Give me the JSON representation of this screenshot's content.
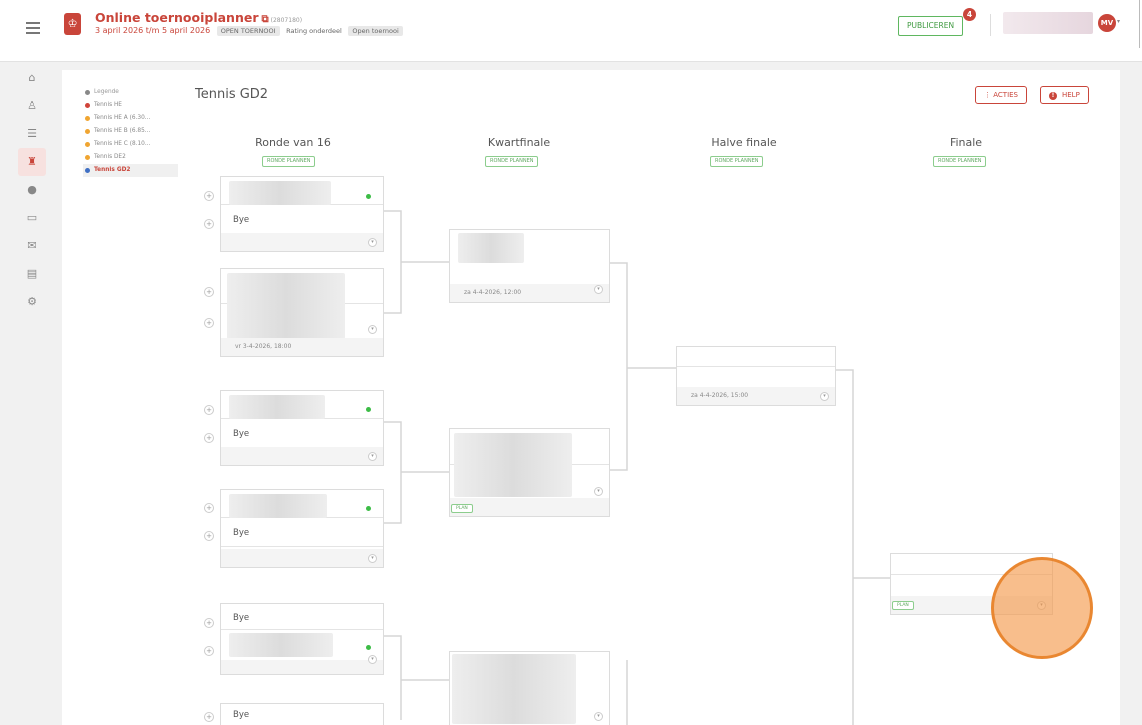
{
  "header": {
    "app_title": "Online toernooiplanner",
    "tournament_id": "(2807180)",
    "dates": "3 april 2026 t/m 5 april 2026",
    "badge_open": "OPEN TOERNOOI",
    "badge_rating": "Rating onderdeel",
    "badge_type": "Open toernooi",
    "publish_label": "PUBLICEREN",
    "notification_count": "4",
    "avatar_initials": "MV"
  },
  "legend": {
    "title": "Legende",
    "items": [
      {
        "label": "Tennis HE",
        "color": "#d0443a"
      },
      {
        "label": "Tennis HE A (6.30...",
        "color": "#f0a531"
      },
      {
        "label": "Tennis HE B (6.85...",
        "color": "#f0a531"
      },
      {
        "label": "Tennis HE C (8.10...",
        "color": "#f0a531"
      },
      {
        "label": "Tennis DE2",
        "color": "#f0a531"
      },
      {
        "label": "Tennis GD2",
        "color": "#3f6fc4",
        "selected": true
      }
    ]
  },
  "page": {
    "title": "Tennis GD2",
    "actions_label": "ACTIES",
    "help_label": "HELP"
  },
  "rounds": [
    {
      "title": "Ronde van 16",
      "plan_label": "RONDE PLANNEN"
    },
    {
      "title": "Kwartfinale",
      "plan_label": "RONDE PLANNEN"
    },
    {
      "title": "Halve finale",
      "plan_label": "RONDE PLANNEN"
    },
    {
      "title": "Finale",
      "plan_label": "RONDE PLANNEN"
    }
  ],
  "matches": {
    "bye": "Bye",
    "r16_m2_time": "vr 3-4-2026, 18:00",
    "qf_m1_time": "za 4-4-2026, 12:00",
    "sf_m1_time": "za 4-4-2026, 15:00",
    "plan_label": "PLAN"
  }
}
